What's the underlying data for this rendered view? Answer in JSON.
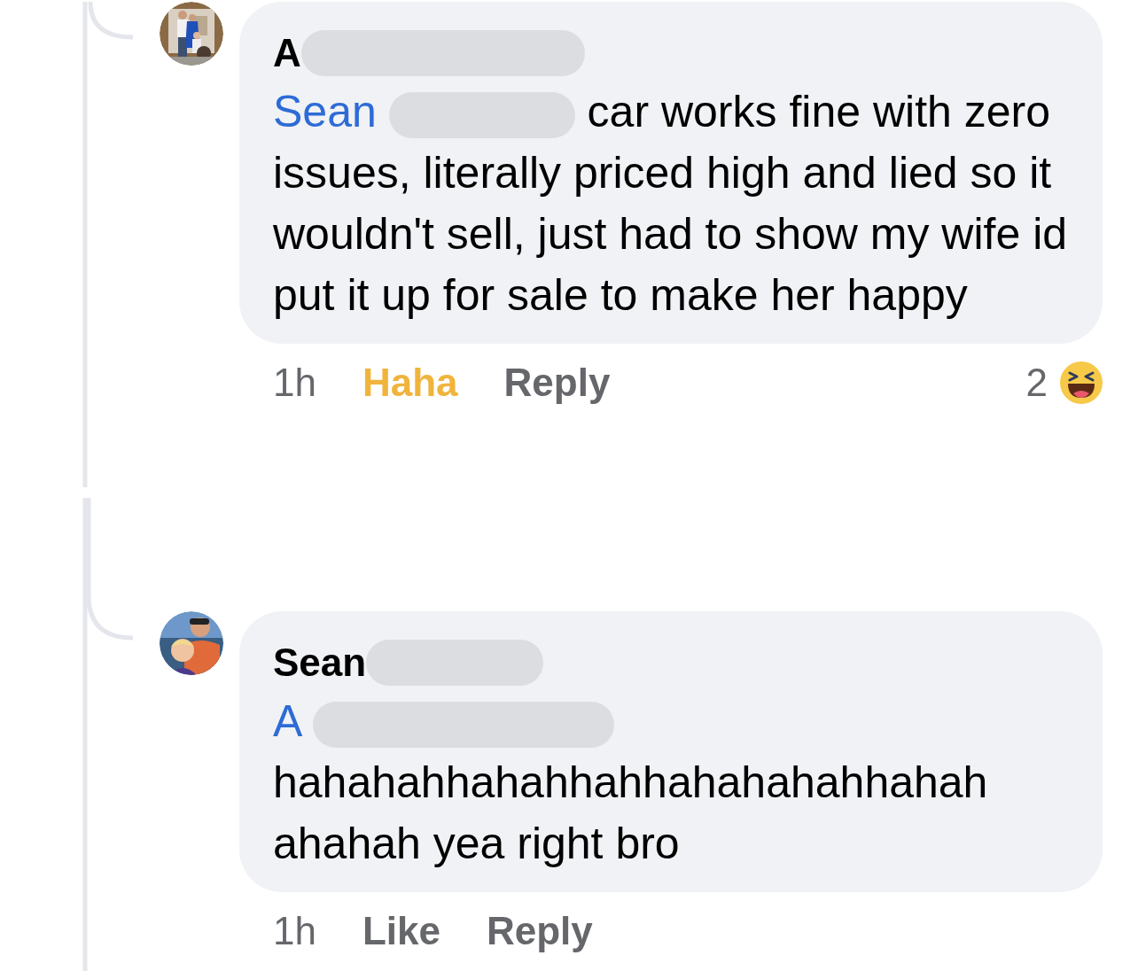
{
  "comments": [
    {
      "author": "A",
      "author_redacted": true,
      "mention": "Sean",
      "mention_redacted": true,
      "text": "car works fine with zero issues, literally priced high and lied so it wouldn't sell, just had to show my wife id put it up for sale to make her happy",
      "time": "1h",
      "reaction": {
        "label": "Haha",
        "selected": true
      },
      "reply": "Reply",
      "reaction_count": "2"
    },
    {
      "author": "Sean",
      "author_redacted": true,
      "mention": "A",
      "mention_redacted": true,
      "text": "hahahahhahahhahhahahahahhahah ahahah yea right bro",
      "time": "1h",
      "reaction": {
        "label": "Like",
        "selected": false
      },
      "reply": "Reply"
    }
  ]
}
